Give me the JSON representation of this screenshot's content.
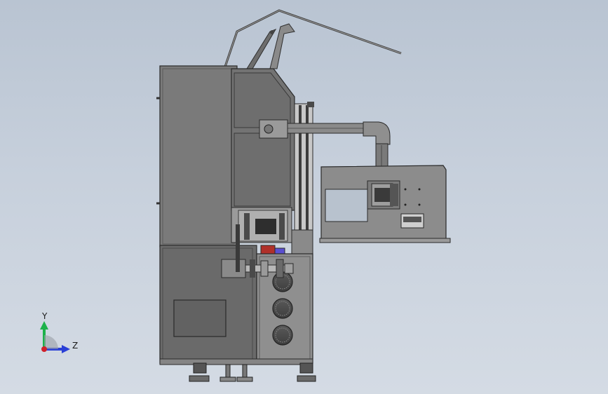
{
  "viewport": {
    "background_top": "#b9c4d2",
    "background_bottom": "#d4dbe4"
  },
  "triad": {
    "y_label": "Y",
    "z_label": "Z",
    "y_color": "#1db24a",
    "z_color": "#2a3fd6",
    "origin_color": "#d0202a"
  },
  "model": {
    "body_color": "#7c7c7c",
    "dark_panel_color": "#6a6a6a",
    "light_panel_color": "#8f8f8f",
    "accent_red": "#b0302a",
    "accent_purple": "#5a4fd0"
  }
}
